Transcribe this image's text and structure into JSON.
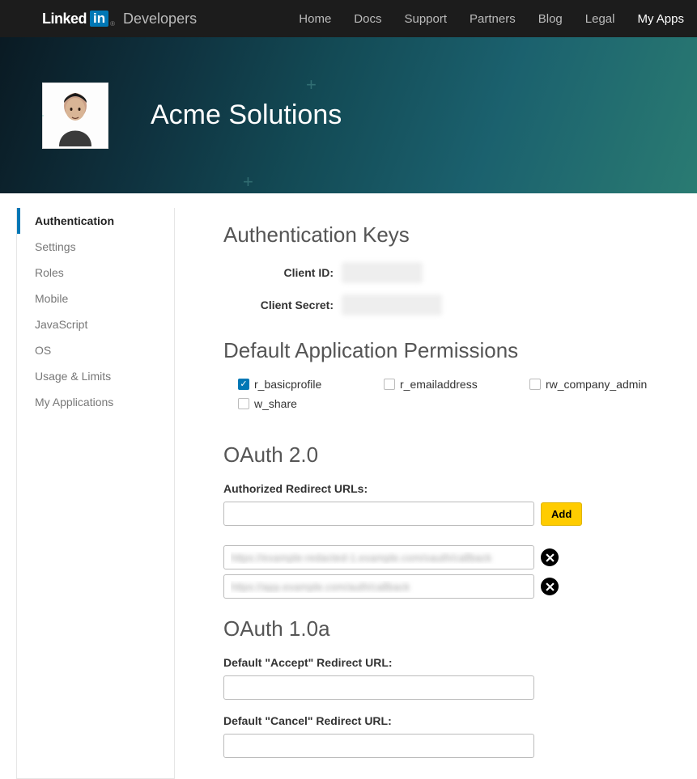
{
  "header": {
    "brand_linked": "Linked",
    "brand_in": "in",
    "brand_dev": "Developers",
    "nav": [
      "Home",
      "Docs",
      "Support",
      "Partners",
      "Blog",
      "Legal",
      "My Apps"
    ],
    "active_nav_index": 6
  },
  "hero": {
    "app_name": "Acme Solutions"
  },
  "sidebar": {
    "items": [
      "Authentication",
      "Settings",
      "Roles",
      "Mobile",
      "JavaScript",
      "OS",
      "Usage & Limits",
      "My Applications"
    ],
    "active_index": 0
  },
  "auth_keys": {
    "title": "Authentication Keys",
    "client_id_label": "Client ID:",
    "client_secret_label": "Client Secret:"
  },
  "permissions": {
    "title": "Default Application Permissions",
    "items": [
      {
        "key": "r_basicprofile",
        "checked": true
      },
      {
        "key": "r_emailaddress",
        "checked": false
      },
      {
        "key": "rw_company_admin",
        "checked": false
      },
      {
        "key": "w_share",
        "checked": false
      }
    ]
  },
  "oauth2": {
    "title": "OAuth 2.0",
    "redirect_label": "Authorized Redirect URLs:",
    "add_label": "Add",
    "urls": [
      "https://example-redacted-1.example.com/oauth/callback",
      "https://app.example.com/auth/callback"
    ]
  },
  "oauth1": {
    "title": "OAuth 1.0a",
    "accept_label": "Default \"Accept\" Redirect URL:",
    "cancel_label": "Default \"Cancel\" Redirect URL:"
  }
}
